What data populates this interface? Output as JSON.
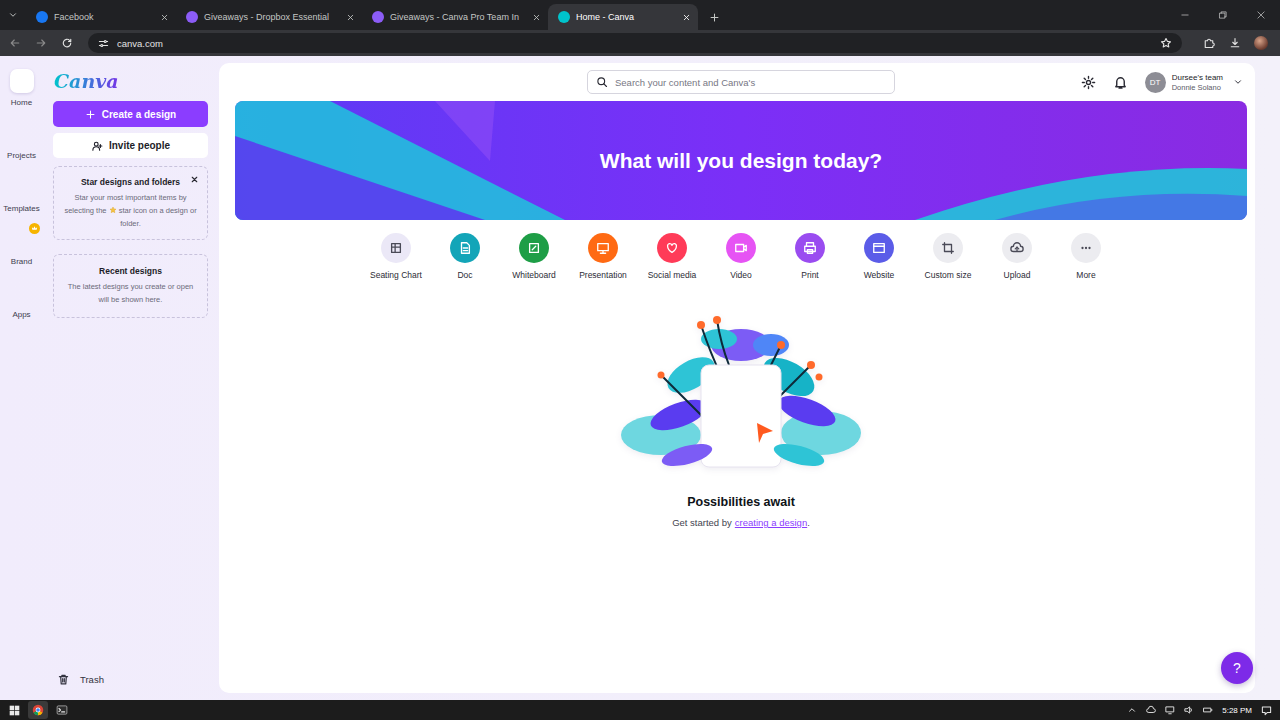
{
  "browser": {
    "tabs": [
      {
        "label": "Facebook",
        "selected": false,
        "color": "#1877f2"
      },
      {
        "label": "Giveaways - Dropbox Essential",
        "selected": false,
        "color": "#8b5cf6"
      },
      {
        "label": "Giveaways - Canva Pro Team In",
        "selected": false,
        "color": "#8b5cf6"
      },
      {
        "label": "Home - Canva",
        "selected": true,
        "color": "#00c4cc"
      }
    ],
    "address": "canva.com"
  },
  "rail": [
    {
      "label": "Home",
      "selected": true,
      "badge": false
    },
    {
      "label": "Projects",
      "selected": false,
      "badge": false
    },
    {
      "label": "Templates",
      "selected": false,
      "badge": false
    },
    {
      "label": "Brand",
      "selected": false,
      "badge": true
    },
    {
      "label": "Apps",
      "selected": false,
      "badge": false
    }
  ],
  "sidebar": {
    "logo": "Canva",
    "create_button": "Create a design",
    "invite_button": "Invite people",
    "star_card": {
      "title": "Star designs and folders",
      "body_before": "Star your most important items by selecting the",
      "body_after": "star icon on a design or folder."
    },
    "recent_card": {
      "title": "Recent designs",
      "body": "The latest designs you create or open will be shown here."
    },
    "trash": "Trash"
  },
  "header": {
    "search_placeholder": "Search your content and Canva's",
    "account": {
      "initials": "DT",
      "team": "Dursee's team",
      "name": "Donnie Solano"
    }
  },
  "hero": {
    "title": "What will you design today?"
  },
  "categories": [
    {
      "label": "Seating Chart",
      "color": "#ebe8f7"
    },
    {
      "label": "Doc",
      "color": "#13a5b8"
    },
    {
      "label": "Whiteboard",
      "color": "#1e9e46"
    },
    {
      "label": "Presentation",
      "color": "#ff6a13"
    },
    {
      "label": "Social media",
      "color": "#ff3b58"
    },
    {
      "label": "Video",
      "color": "#e654f4"
    },
    {
      "label": "Print",
      "color": "#9a4cf0"
    },
    {
      "label": "Website",
      "color": "#5b5ce8"
    },
    {
      "label": "Custom size",
      "color": "#ececf0"
    },
    {
      "label": "Upload",
      "color": "#ececf0"
    },
    {
      "label": "More",
      "color": "#ececf0"
    }
  ],
  "empty_state": {
    "title": "Possibilities await",
    "prefix": "Get started by",
    "link": "creating a design",
    "suffix": "."
  },
  "help_button": "?",
  "taskbar": {
    "time": "5:28 PM"
  }
}
